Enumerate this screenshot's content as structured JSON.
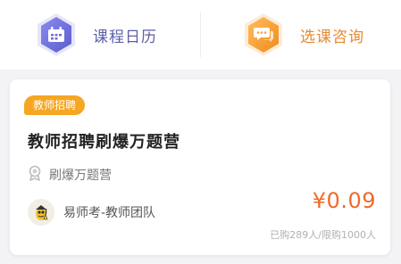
{
  "shortcuts": [
    {
      "label": "课程日历",
      "icon": "calendar-icon",
      "color": "#6d6fd8"
    },
    {
      "label": "选课咨询",
      "icon": "chat-icon",
      "color": "#f5a23a"
    }
  ],
  "course_card": {
    "tag": "教师招聘",
    "title": "教师招聘刷爆万题营",
    "subtitle": "刷爆万题营",
    "subtitle_icon": "medal-icon",
    "teacher": "易师考-教师团队",
    "teacher_icon": "avatar-icon",
    "price": "¥0.09",
    "enroll_info": "已购289人/限购1000人",
    "price_color": "#f06a2a",
    "tag_color": "#f5a623"
  }
}
